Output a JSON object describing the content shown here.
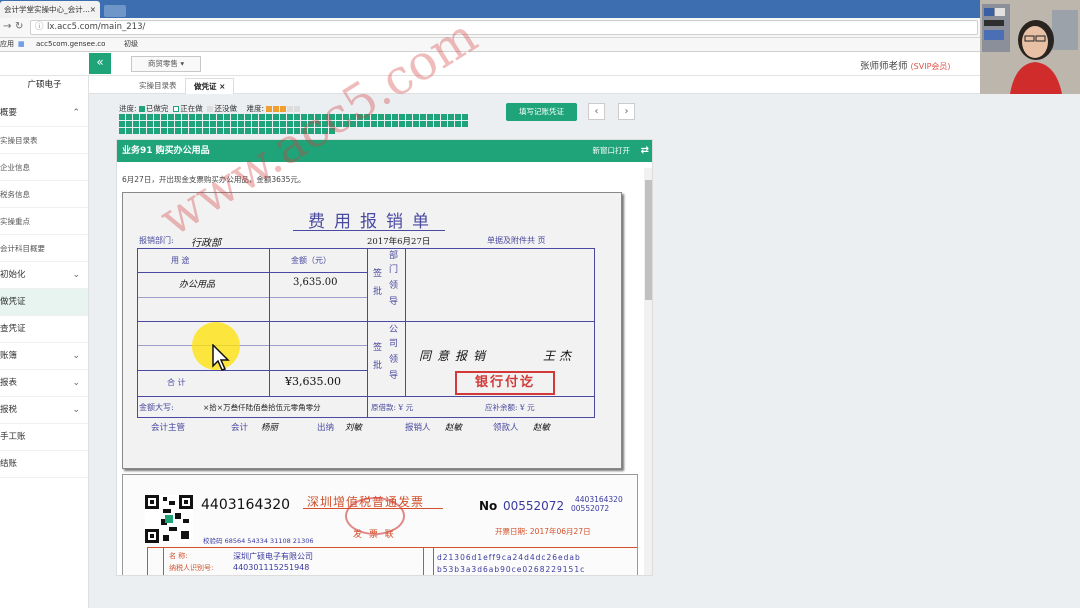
{
  "browser": {
    "tab_title": "会计学堂实操中心_会计...",
    "tab_close": "×",
    "url": "lx.acc5.com/main_213/",
    "bookmarks_label": "应用",
    "bookmark1": "acc5com.gensee.co",
    "bookmark2": "初级"
  },
  "header": {
    "collapse_icon": "«",
    "shop_button": "商贸零售",
    "user_name": "张师师老师",
    "user_badge": "(SVIP会员)"
  },
  "sidebar": {
    "company": "广硕电子",
    "items": [
      {
        "label": "概要",
        "icon": "chevron-up"
      },
      {
        "label": "实操目录表"
      },
      {
        "label": "企业信息"
      },
      {
        "label": "税务信息"
      },
      {
        "label": "实操重点"
      },
      {
        "label": "会计科目概要"
      },
      {
        "label": "初始化",
        "icon": "chevron-down"
      },
      {
        "label": "做凭证"
      },
      {
        "label": "查凭证"
      },
      {
        "label": "账簿",
        "icon": "chevron-down"
      },
      {
        "label": "报表",
        "icon": "chevron-down"
      },
      {
        "label": "报税",
        "icon": "chevron-down"
      },
      {
        "label": "手工账"
      },
      {
        "label": "结账"
      }
    ]
  },
  "page_tabs": [
    {
      "label": "实操目录表"
    },
    {
      "label": "做凭证",
      "close": "×"
    }
  ],
  "progress": {
    "label": "进度:",
    "done": "已做完",
    "doing": "正在做",
    "todo": "还没做",
    "difficulty": "难度:",
    "rows": [
      50,
      50,
      31
    ],
    "current_index": 143
  },
  "actions": {
    "book_button": "填写记账凭证",
    "prev": "‹",
    "next": "›"
  },
  "task": {
    "title": "业务91 购买办公用品",
    "open_new": "新窗口打开",
    "swap_icon": "⇄",
    "description": "6月27日，开出现金支票购买办公用品，金额3635元。"
  },
  "voucher": {
    "title": "费用报销单",
    "dept_label": "报销部门:",
    "dept": "行政部",
    "date": "2017年6月27日",
    "attach": "单据及附件共 页",
    "col_use": "用  途",
    "col_amount": "金额（元）",
    "dept_sign": [
      "部",
      "门",
      "签",
      "领",
      "批",
      "导"
    ],
    "co_sign": [
      "公",
      "司",
      "签",
      "领",
      "批",
      "导"
    ],
    "item": "办公用品",
    "item_amount": "3,635.00",
    "total_label": "合  计",
    "total": "¥3,635.00",
    "approval": "同意报销",
    "approver": "王杰",
    "stamp": "银行付讫",
    "words_label": "金额大写:",
    "words": "×拾×万叁仟陆佰叁拾伍元零角零分",
    "borrow": "原借款: ¥        元",
    "refund": "应补余额: ¥        元",
    "sign_row": [
      "会计主管",
      "会计",
      "杨丽",
      "出纳",
      "刘敏",
      "报销人",
      "赵敏",
      "领款人",
      "赵敏"
    ]
  },
  "invoice": {
    "code": "4403164320",
    "title": "深圳增值税普通发票",
    "no_label": "No",
    "number": "00552072",
    "small_code": "4403164320",
    "small_no": "00552072",
    "issue_date": "开票日期: 2017年06月27日",
    "check_code": "校验码 68564 54334 31108 21306",
    "stamp_text": "发 票 联",
    "buyer_name_label": "名    称:",
    "buyer_name": "深圳广硕电子有限公司",
    "tax_id_label": "纳税人识别号:",
    "tax_id": "440301115251948",
    "cipher1": "d21306d1eff9ca24d4dc26edab",
    "cipher2": "b53b3a3d6ab90ce0268229151c"
  },
  "watermark": "www.acc5.com"
}
